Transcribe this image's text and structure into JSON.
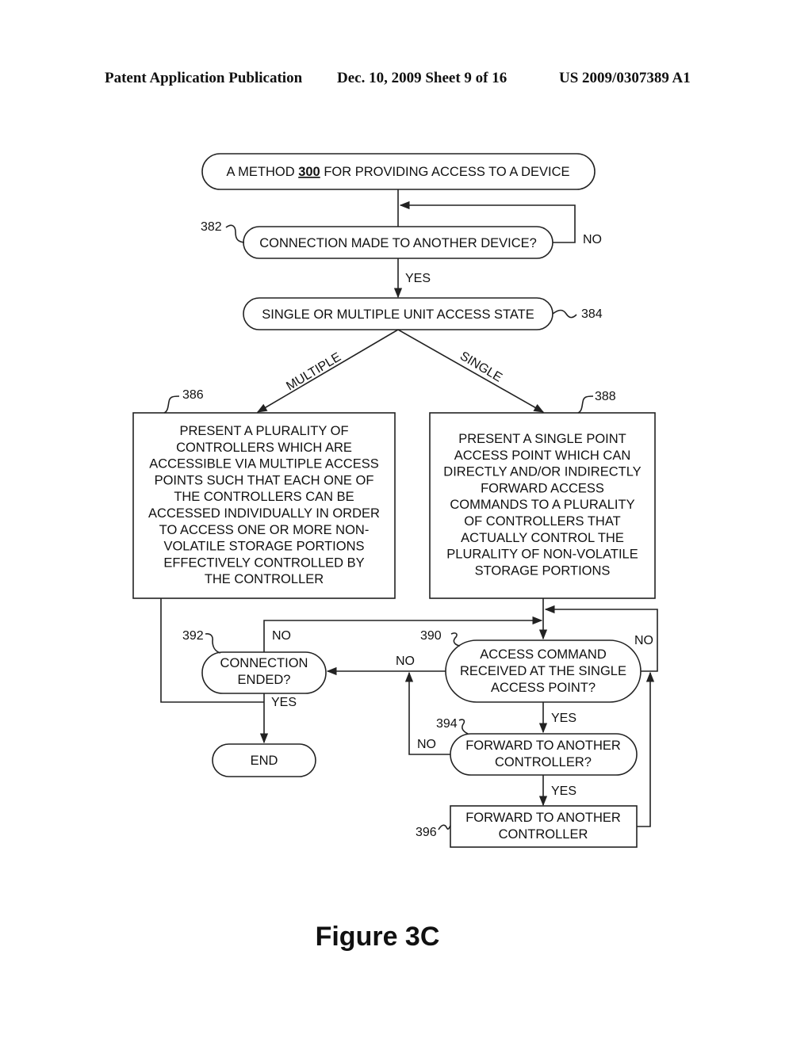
{
  "header": {
    "publication": "Patent Application Publication",
    "date_sheet": "Dec. 10, 2009   Sheet 9 of 16",
    "number": "US 2009/0307389 A1"
  },
  "figure_label": "Figure 3C",
  "nodes": {
    "start": {
      "prefix": "A METHOD ",
      "method_number": "300",
      "suffix": " FOR PROVIDING ACCESS TO A DEVICE"
    },
    "n382": {
      "ref": "382",
      "text": "CONNECTION MADE TO ANOTHER DEVICE?"
    },
    "n384": {
      "ref": "384",
      "text": "SINGLE OR MULTIPLE UNIT ACCESS STATE"
    },
    "n386": {
      "ref": "386",
      "lines": [
        "PRESENT A PLURALITY OF",
        "CONTROLLERS WHICH ARE",
        "ACCESSIBLE VIA MULTIPLE ACCESS",
        "POINTS SUCH THAT EACH ONE OF",
        "THE CONTROLLERS CAN BE",
        "ACCESSED INDIVIDUALLY IN ORDER",
        "TO ACCESS ONE OR MORE NON-",
        "VOLATILE STORAGE PORTIONS",
        "EFFECTIVELY CONTROLLED BY",
        "THE CONTROLLER"
      ]
    },
    "n388": {
      "ref": "388",
      "lines": [
        "PRESENT A SINGLE POINT",
        "ACCESS POINT WHICH CAN",
        "DIRECTLY AND/OR INDIRECTLY",
        "FORWARD ACCESS",
        "COMMANDS TO A PLURALITY",
        "OF CONTROLLERS THAT",
        "ACTUALLY CONTROL THE",
        "PLURALITY OF NON-VOLATILE",
        "STORAGE PORTIONS"
      ]
    },
    "n390": {
      "ref": "390",
      "lines": [
        "ACCESS COMMAND",
        "RECEIVED AT THE SINGLE",
        "ACCESS POINT?"
      ]
    },
    "n392": {
      "ref": "392",
      "lines": [
        "CONNECTION",
        "ENDED?"
      ]
    },
    "n394": {
      "ref": "394",
      "lines": [
        "FORWARD TO ANOTHER",
        "CONTROLLER?"
      ]
    },
    "n396": {
      "ref": "396",
      "lines": [
        "FORWARD TO ANOTHER",
        "CONTROLLER"
      ]
    },
    "end": {
      "text": "END"
    }
  },
  "edge_labels": {
    "n382_no": "NO",
    "n382_yes": "YES",
    "multiple": "MULTIPLE",
    "single": "SINGLE",
    "n392_no": "NO",
    "n392_yes": "YES",
    "n390_no_left": "NO",
    "n390_no_right": "NO",
    "n390_yes": "YES",
    "n394_no": "NO",
    "n394_yes": "YES"
  }
}
